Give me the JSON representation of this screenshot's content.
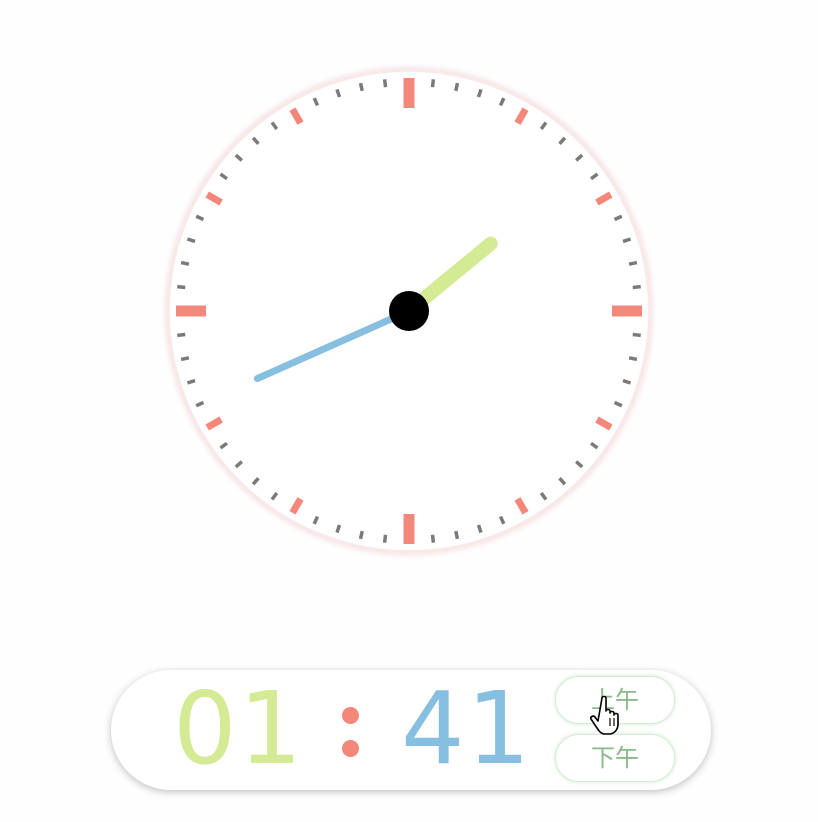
{
  "clock": {
    "hours": 1,
    "minutes": 41,
    "period": "上午",
    "colors": {
      "face": "#ffffff",
      "rim_glow": "#f3d6d6",
      "major_tick": "#f4867a",
      "minor_tick": "#7a7a7a",
      "hour_hand": "#d4ea94",
      "minute_hand": "#86bfdf",
      "center_pin": "#000000"
    }
  },
  "digital": {
    "hour_text": "01",
    "minute_text": "41",
    "colors": {
      "hour": "#d4ea94",
      "minute": "#86bfdf",
      "colon": "#f4867a",
      "button_text": "#8ab98a"
    }
  },
  "buttons": {
    "am_label": "上午",
    "pm_label": "下午"
  },
  "icons": {
    "cursor": "hand-pointer-icon"
  }
}
